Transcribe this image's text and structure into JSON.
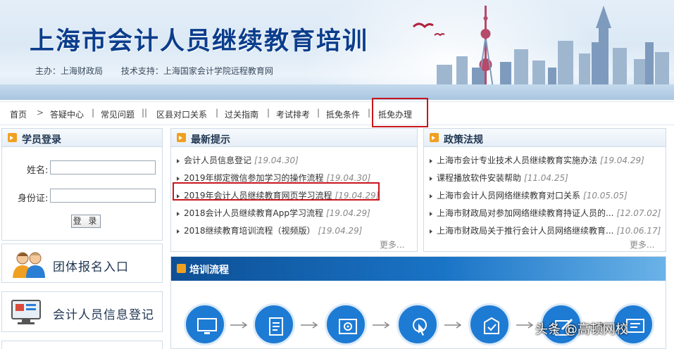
{
  "banner": {
    "title": "上海市会计人员继续教育培训",
    "sponsor": "主办：上海财政局",
    "tech_support": "技术支持：上海国家会计学院远程教育网"
  },
  "nav": {
    "items": [
      "首页",
      ">",
      "答疑中心",
      "|",
      "常见问题",
      "||",
      "区县对口关系",
      "|",
      "过关指南",
      "|",
      "考试排考",
      "|",
      "抵免条件",
      "|",
      "抵免办理"
    ]
  },
  "login": {
    "title": "学员登录",
    "name_label": "姓名:",
    "id_label": "身份证:",
    "submit": "登 录"
  },
  "entries": {
    "group": "团体报名入口",
    "info": "会计人员信息登记"
  },
  "news": {
    "title": "最新提示",
    "items": [
      {
        "text": "会计人员信息登记",
        "date": "[19.04.30]"
      },
      {
        "text": "2019年绑定微信参加学习的操作流程",
        "date": "[19.04.30]"
      },
      {
        "text": "2019年会计人员继续教育网页学习流程",
        "date": "[19.04.29]"
      },
      {
        "text": "2018会计人员继续教育App学习流程",
        "date": "[19.04.29]"
      },
      {
        "text": "2018继续教育培训流程（视频版）",
        "date": "[19.04.29]"
      }
    ],
    "more": "更多..."
  },
  "policy": {
    "title": "政策法规",
    "items": [
      {
        "text": "上海市会计专业技术人员继续教育实施办法",
        "date": "[19.04.29]"
      },
      {
        "text": "课程播放软件安装帮助",
        "date": "[11.04.25]"
      },
      {
        "text": "上海市会计人员网络继续教育对口关系",
        "date": "[10.05.05]"
      },
      {
        "text": "上海市财政局对参加网络继续教育持证人员的...",
        "date": "[12.07.02]"
      },
      {
        "text": "上海市财政局关于推行会计人员网络继续教育...",
        "date": "[10.06.17]"
      }
    ],
    "more": "更多..."
  },
  "flow": {
    "title": "培训流程",
    "step_icons": [
      "monitor-icon",
      "document-icon",
      "disc-icon",
      "click-icon",
      "checklist-icon",
      "edit-icon",
      "certificate-icon"
    ]
  },
  "watermark": "头条 @高顿网校",
  "colors": {
    "brand_blue": "#0b3d8c",
    "highlight_red": "#c8161d",
    "flow_blue": "#1e7bd4",
    "header_icon_orange": "#f0a020"
  }
}
